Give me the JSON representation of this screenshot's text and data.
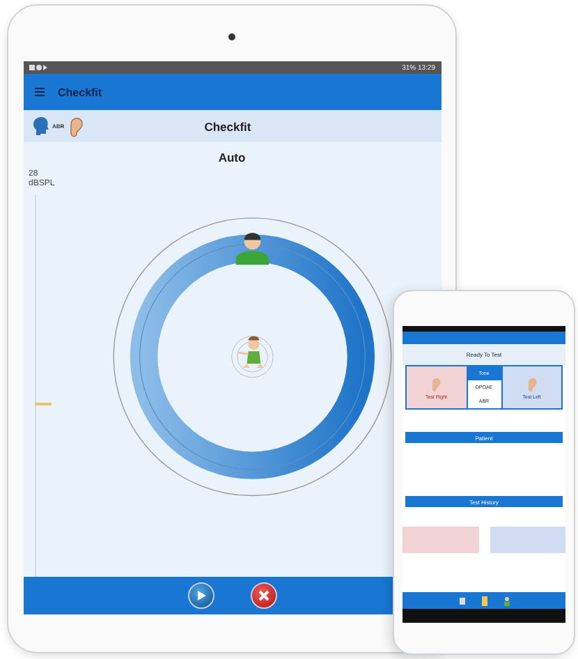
{
  "tablet": {
    "status_bar": {
      "battery": "31%",
      "time": "13:29"
    },
    "app_bar": {
      "title": "Checkfit"
    },
    "header": {
      "mode_label": "ABR",
      "title": "Checkfit"
    },
    "test": {
      "title": "Auto",
      "reading": "28",
      "unit": "dBSPL",
      "level": 0.45
    }
  },
  "phone": {
    "status": "Ready To Test",
    "ears": [
      {
        "label": "Test Right",
        "kind": "right"
      },
      {
        "label": "Test Left",
        "kind": "left"
      }
    ],
    "modes": [
      {
        "label": "Tone",
        "selected": true
      },
      {
        "label": "DPOAE",
        "selected": false
      },
      {
        "label": "ABR",
        "selected": false
      }
    ],
    "patient_bar": "Patient",
    "history_bar": "Test History"
  }
}
